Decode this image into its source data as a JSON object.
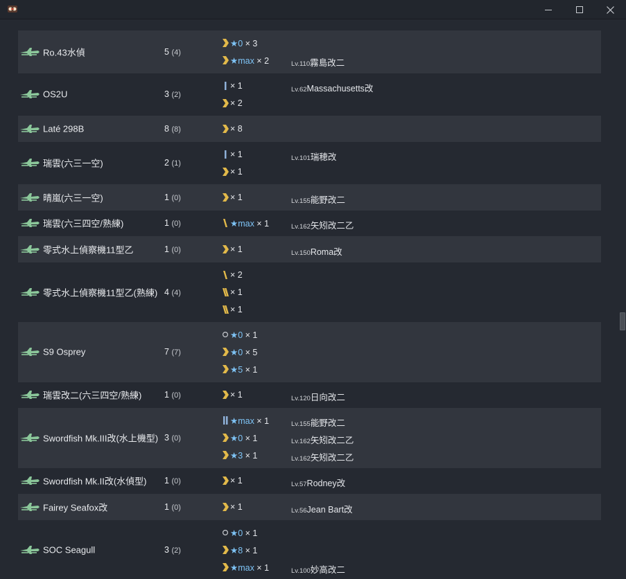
{
  "colors": {
    "background": "#252931",
    "row_shade": "#32363e",
    "star": "#7ec3f5",
    "plane_icon": "#8bc79a",
    "proficiency_gold": "#e2b94a",
    "proficiency_blue": "#8fb1d9"
  },
  "window": {
    "app_icon": "kancolle-app-icon",
    "buttons": [
      "minimize-icon",
      "maximize-icon",
      "close-icon"
    ]
  },
  "rows": [
    {
      "name": "Ro.43水偵",
      "count": "5",
      "count_paren": "(4)",
      "entries": [
        {
          "prof": "chevron-icon",
          "star": "★0",
          "qty": " × 3",
          "lv": "",
          "ship": ""
        },
        {
          "prof": "chevron-icon",
          "star": "★max",
          "qty": " × 2",
          "lv": "Lv.110",
          "ship": "霧島改二"
        }
      ]
    },
    {
      "name": "OS2U",
      "count": "3",
      "count_paren": "(2)",
      "entries": [
        {
          "prof": "bar-icon",
          "star": "",
          "qty": "× 1",
          "lv": "Lv.62",
          "ship": "Massachusetts改"
        },
        {
          "prof": "chevron-icon",
          "star": "",
          "qty": "× 2",
          "lv": "",
          "ship": ""
        }
      ]
    },
    {
      "name": "Laté 298B",
      "count": "8",
      "count_paren": "(8)",
      "entries": [
        {
          "prof": "chevron-icon",
          "star": "",
          "qty": "× 8",
          "lv": "",
          "ship": ""
        }
      ]
    },
    {
      "name": "瑞雲(六三一空)",
      "count": "2",
      "count_paren": "(1)",
      "entries": [
        {
          "prof": "bar-icon",
          "star": "",
          "qty": "× 1",
          "lv": "Lv.101",
          "ship": "瑞穂改"
        },
        {
          "prof": "chevron-icon",
          "star": "",
          "qty": "× 1",
          "lv": "",
          "ship": ""
        }
      ]
    },
    {
      "name": "晴嵐(六三一空)",
      "count": "1",
      "count_paren": "(0)",
      "entries": [
        {
          "prof": "chevron-icon",
          "star": "",
          "qty": "× 1",
          "lv": "Lv.155",
          "ship": "能野改二"
        }
      ]
    },
    {
      "name": "瑞雲(六三四空/熟練)",
      "count": "1",
      "count_paren": "(0)",
      "entries": [
        {
          "prof": "slash-icon",
          "star": "★max",
          "qty": " × 1",
          "lv": "Lv.162",
          "ship": "矢矧改二乙"
        }
      ]
    },
    {
      "name": "零式水上偵察機11型乙",
      "count": "1",
      "count_paren": "(0)",
      "entries": [
        {
          "prof": "chevron-icon",
          "star": "",
          "qty": "× 1",
          "lv": "Lv.150",
          "ship": "Roma改"
        }
      ]
    },
    {
      "name": "零式水上偵察機11型乙(熟練)",
      "count": "4",
      "count_paren": "(4)",
      "entries": [
        {
          "prof": "slash-icon",
          "star": "",
          "qty": "× 2",
          "lv": "",
          "ship": ""
        },
        {
          "prof": "double-slash-icon",
          "star": "",
          "qty": "× 1",
          "lv": "",
          "ship": ""
        },
        {
          "prof": "double-slash-icon",
          "star": "",
          "qty": "× 1",
          "lv": "",
          "ship": ""
        }
      ]
    },
    {
      "name": "S9 Osprey",
      "count": "7",
      "count_paren": "(7)",
      "entries": [
        {
          "prof": "circle-icon",
          "star": "★0",
          "qty": " × 1",
          "lv": "",
          "ship": ""
        },
        {
          "prof": "chevron-icon",
          "star": "★0",
          "qty": " × 5",
          "lv": "",
          "ship": ""
        },
        {
          "prof": "chevron-icon",
          "star": "★5",
          "qty": " × 1",
          "lv": "",
          "ship": ""
        }
      ]
    },
    {
      "name": "瑞雲改二(六三四空/熟練)",
      "count": "1",
      "count_paren": "(0)",
      "entries": [
        {
          "prof": "chevron-icon",
          "star": "",
          "qty": "× 1",
          "lv": "Lv.120",
          "ship": "日向改二"
        }
      ]
    },
    {
      "name": "Swordfish Mk.III改(水上機型)",
      "count": "3",
      "count_paren": "(0)",
      "entries": [
        {
          "prof": "double-bar-icon",
          "star": "★max",
          "qty": " × 1",
          "lv": "Lv.155",
          "ship": "能野改二"
        },
        {
          "prof": "chevron-icon",
          "star": "★0",
          "qty": " × 1",
          "lv": "Lv.162",
          "ship": "矢矧改二乙"
        },
        {
          "prof": "chevron-icon",
          "star": "★3",
          "qty": " × 1",
          "lv": "Lv.162",
          "ship": "矢矧改二乙"
        }
      ]
    },
    {
      "name": "Swordfish Mk.II改(水偵型)",
      "count": "1",
      "count_paren": "(0)",
      "entries": [
        {
          "prof": "chevron-icon",
          "star": "",
          "qty": "× 1",
          "lv": "Lv.57",
          "ship": "Rodney改"
        }
      ]
    },
    {
      "name": "Fairey Seafox改",
      "count": "1",
      "count_paren": "(0)",
      "entries": [
        {
          "prof": "chevron-icon",
          "star": "",
          "qty": "× 1",
          "lv": "Lv.56",
          "ship": "Jean Bart改"
        }
      ]
    },
    {
      "name": "SOC Seagull",
      "count": "3",
      "count_paren": "(2)",
      "entries": [
        {
          "prof": "circle-icon",
          "star": "★0",
          "qty": " × 1",
          "lv": "",
          "ship": ""
        },
        {
          "prof": "chevron-icon",
          "star": "★8",
          "qty": " × 1",
          "lv": "",
          "ship": ""
        },
        {
          "prof": "chevron-icon",
          "star": "★max",
          "qty": " × 1",
          "lv": "Lv.100",
          "ship": "妙高改二"
        }
      ]
    }
  ]
}
